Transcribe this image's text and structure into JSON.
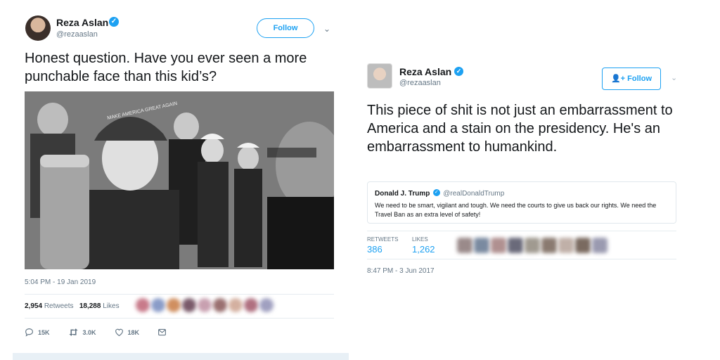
{
  "left_tweet": {
    "author_name": "Reza Aslan",
    "handle": "@rezaaslan",
    "verified_icon": "✓",
    "follow_label": "Follow",
    "caret": "⌄",
    "text": "Honest question. Have you ever seen a more punchable face than this kid’s?",
    "photo_hat_text": "MAKE AMERICA GREAT AGAIN",
    "timestamp": "5:04 PM - 19 Jan 2019",
    "retweets_count": "2,954",
    "retweets_label": "Retweets",
    "likes_count": "18,288",
    "likes_label": "Likes",
    "reply_count": "15K",
    "retweet_action_count": "3.0K",
    "like_action_count": "18K",
    "icons": [
      "reply-icon",
      "retweet-icon",
      "like-icon",
      "message-icon"
    ]
  },
  "right_tweet": {
    "author_name": "Reza Aslan",
    "handle": "@rezaaslan",
    "verified_icon": "✓",
    "follow_label": "Follow",
    "caret": "⌄",
    "text": "This piece of shit is not just an embarrassment to America and a stain on the presidency. He's an embarrassment to humankind.",
    "quoted": {
      "name": "Donald J. Trump",
      "handle": "@realDonaldTrump",
      "text": "We need to be smart, vigilant and tough. We need the courts to give us back our rights. We need the Travel Ban as an extra level of safety!"
    },
    "retweets_label": "RETWEETS",
    "retweets_value": "386",
    "likes_label": "LIKES",
    "likes_value": "1,262",
    "timestamp": "8:47 PM - 3 Jun 2017"
  },
  "colors": {
    "accent": "#1da1f2",
    "secondary_text": "#657786",
    "primary_text": "#14171a",
    "divider": "#e6ecf0"
  }
}
